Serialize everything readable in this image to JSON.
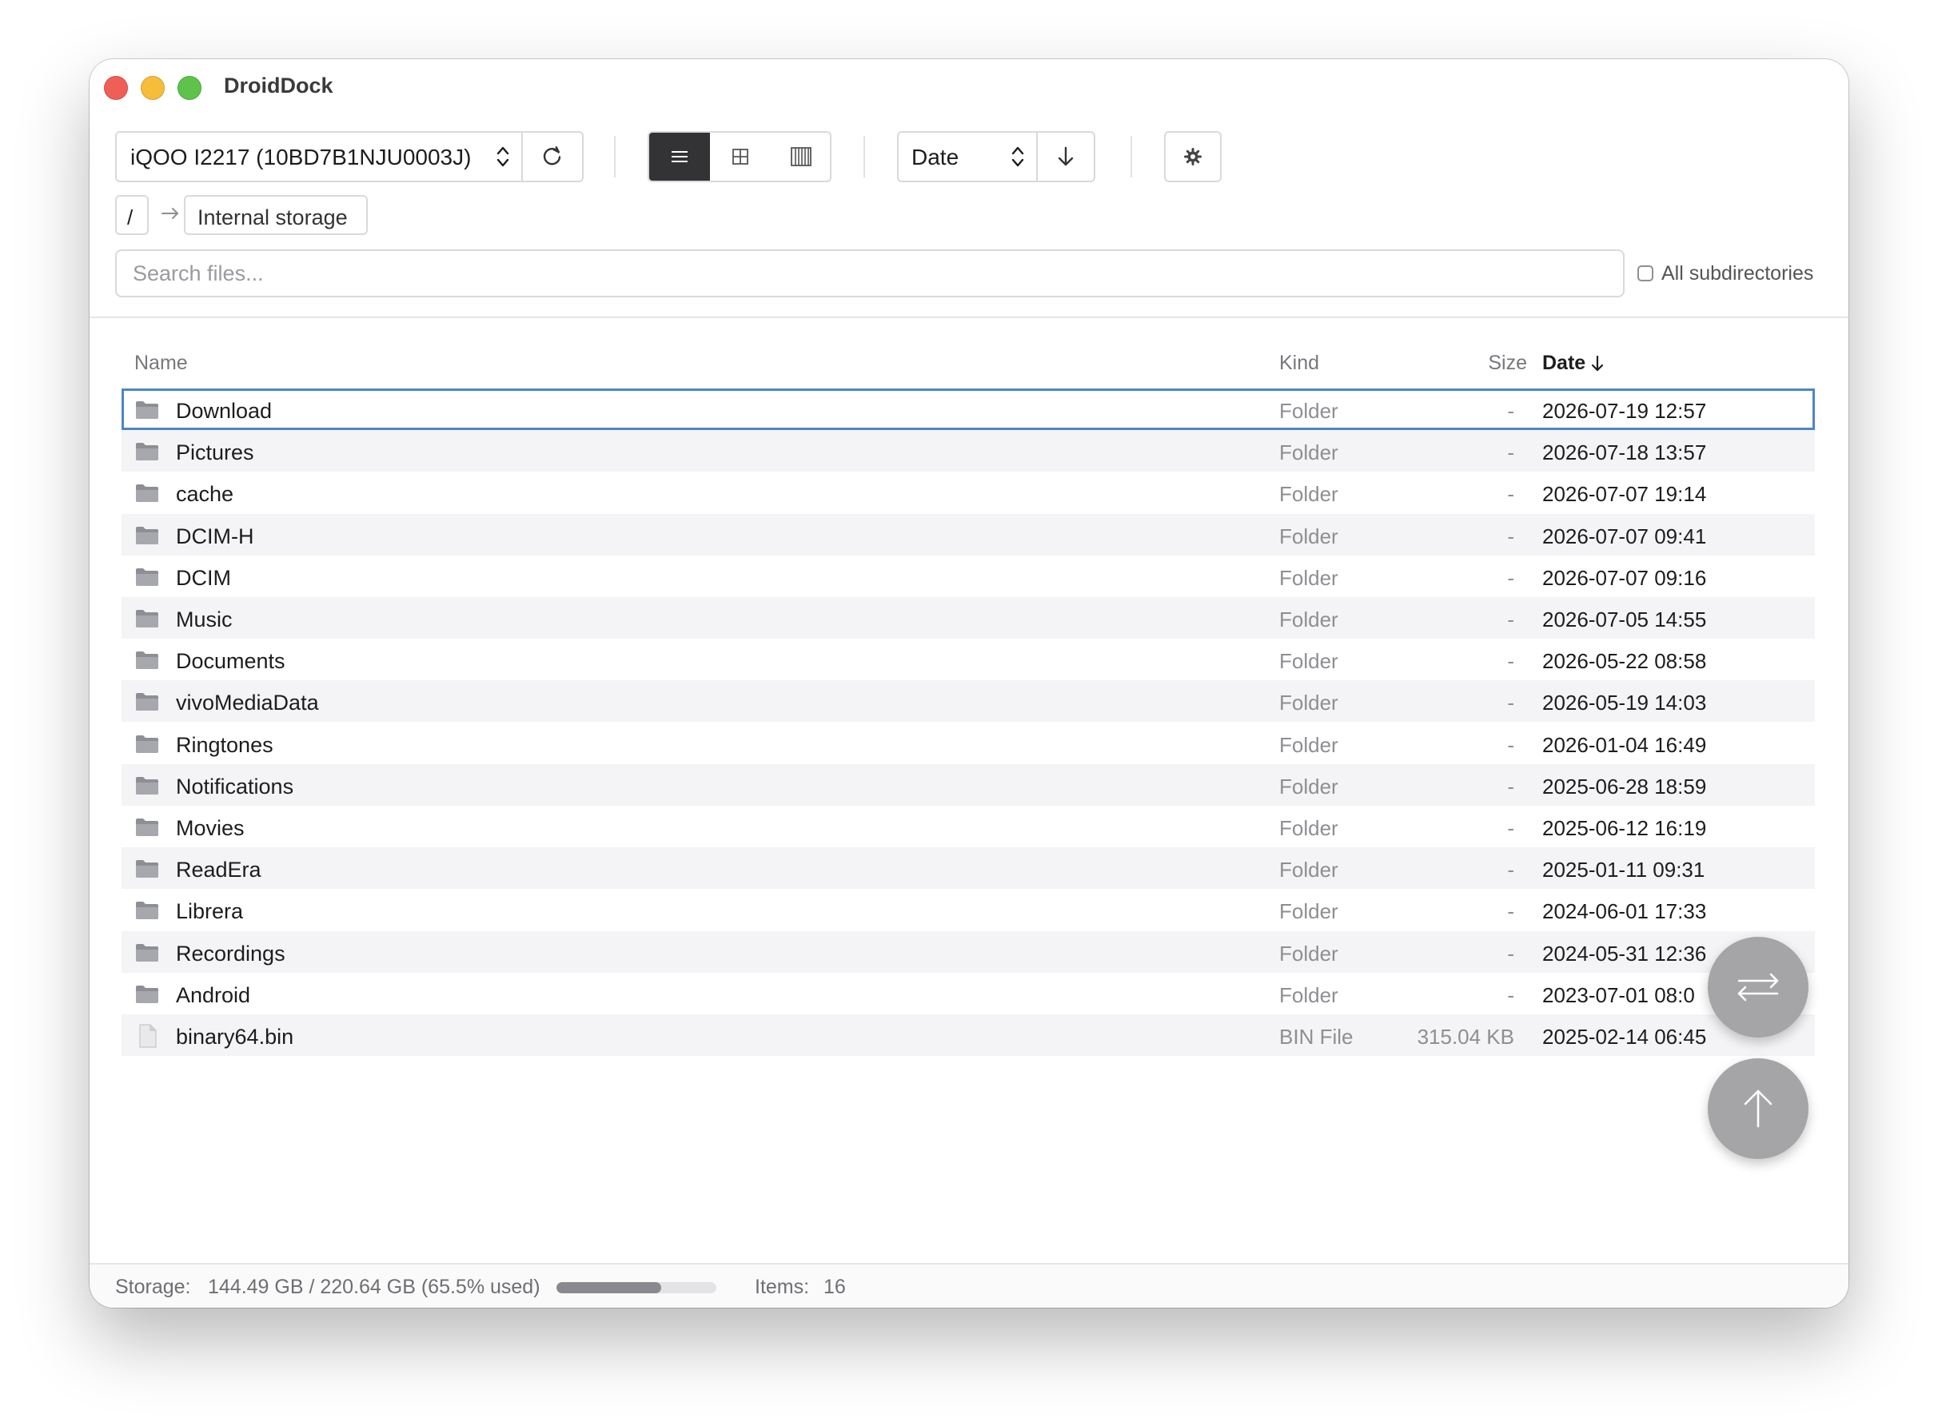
{
  "app": {
    "title": "DroidDock"
  },
  "toolbar": {
    "device": "iQOO I2217 (10BD7B1NJU0003J)",
    "sort_field": "Date",
    "view_modes": [
      "list",
      "grid",
      "columns"
    ],
    "active_view": "list"
  },
  "breadcrumb": {
    "root": "/",
    "items": [
      "Internal storage"
    ]
  },
  "search": {
    "placeholder": "Search files...",
    "value": "",
    "all_subdirs_label": "All subdirectories",
    "all_subdirs_checked": false
  },
  "table": {
    "headers": {
      "name": "Name",
      "kind": "Kind",
      "size": "Size",
      "date": "Date"
    },
    "sort": {
      "column": "date",
      "direction": "desc"
    },
    "rows": [
      {
        "name": "Download",
        "kind": "Folder",
        "size": "-",
        "date": "2026-07-19 12:57",
        "type": "folder"
      },
      {
        "name": "Pictures",
        "kind": "Folder",
        "size": "-",
        "date": "2026-07-18 13:57",
        "type": "folder"
      },
      {
        "name": "cache",
        "kind": "Folder",
        "size": "-",
        "date": "2026-07-07 19:14",
        "type": "folder"
      },
      {
        "name": "DCIM-H",
        "kind": "Folder",
        "size": "-",
        "date": "2026-07-07 09:41",
        "type": "folder"
      },
      {
        "name": "DCIM",
        "kind": "Folder",
        "size": "-",
        "date": "2026-07-07 09:16",
        "type": "folder"
      },
      {
        "name": "Music",
        "kind": "Folder",
        "size": "-",
        "date": "2026-07-05 14:55",
        "type": "folder"
      },
      {
        "name": "Documents",
        "kind": "Folder",
        "size": "-",
        "date": "2026-05-22 08:58",
        "type": "folder"
      },
      {
        "name": "vivoMediaData",
        "kind": "Folder",
        "size": "-",
        "date": "2026-05-19 14:03",
        "type": "folder"
      },
      {
        "name": "Ringtones",
        "kind": "Folder",
        "size": "-",
        "date": "2026-01-04 16:49",
        "type": "folder"
      },
      {
        "name": "Notifications",
        "kind": "Folder",
        "size": "-",
        "date": "2025-06-28 18:59",
        "type": "folder"
      },
      {
        "name": "Movies",
        "kind": "Folder",
        "size": "-",
        "date": "2025-06-12 16:19",
        "type": "folder"
      },
      {
        "name": "ReadEra",
        "kind": "Folder",
        "size": "-",
        "date": "2025-01-11 09:31",
        "type": "folder"
      },
      {
        "name": "Librera",
        "kind": "Folder",
        "size": "-",
        "date": "2024-06-01 17:33",
        "type": "folder"
      },
      {
        "name": "Recordings",
        "kind": "Folder",
        "size": "-",
        "date": "2024-05-31 12:36",
        "type": "folder"
      },
      {
        "name": "Android",
        "kind": "Folder",
        "size": "-",
        "date": "2023-07-01 08:0",
        "type": "folder"
      },
      {
        "name": "binary64.bin",
        "kind": "BIN File",
        "size": "315.04 KB",
        "date": "2025-02-14 06:45",
        "type": "file"
      }
    ]
  },
  "status": {
    "storage_label": "Storage:",
    "storage_value": "144.49 GB / 220.64 GB (65.5% used)",
    "storage_used_fraction": 0.655,
    "items_label": "Items:",
    "items_value": "16"
  },
  "colors": {
    "selection": "#4b86c9",
    "active_toggle": "#333336",
    "fab": "#a5a5a8"
  }
}
